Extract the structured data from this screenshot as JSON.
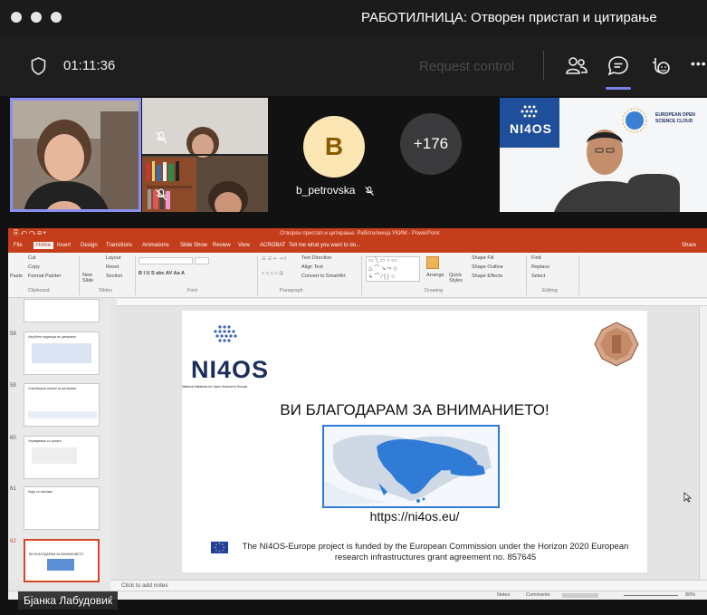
{
  "window": {
    "title": "РАБОТИЛНИЦА: Отворен пристап и цитирање"
  },
  "meeting": {
    "timer": "01:11:36",
    "request_control_label": "Request control",
    "toolbar_icons": [
      "participants-icon",
      "chat-icon",
      "reactions-icon",
      "more-options-icon"
    ],
    "more_label": "•••"
  },
  "participants": {
    "avatar_initial": "B",
    "avatar_name": "b_petrovska",
    "overflow_count": "+176",
    "presenter_name": "Бјанка Лабудовиќ"
  },
  "powerpoint": {
    "title_text": "Отворен пристап и цитирање. Работилница УКИМ - PowerPoint",
    "tabs": [
      "File",
      "Home",
      "Insert",
      "Design",
      "Transitions",
      "Animations",
      "Slide Show",
      "Review",
      "View",
      "ACROBAT",
      "Tell me what you want to do..."
    ],
    "share_label": "Share",
    "ribbon_groups": [
      "Clipboard",
      "Slides",
      "Font",
      "Paragraph",
      "Drawing",
      "Editing"
    ],
    "ribbon_items": {
      "cut": "Cut",
      "copy": "Copy",
      "format_painter": "Format Painter",
      "paste": "Paste",
      "new_slide": "New Slide",
      "layout": "Layout",
      "reset": "Reset",
      "section": "Section",
      "text_direction": "Text Direction",
      "align_text": "Align Text",
      "convert_smartart": "Convert to SmartArt",
      "arrange": "Arrange",
      "quick_styles": "Quick Styles",
      "shape_fill": "Shape Fill",
      "shape_outline": "Shape Outline",
      "shape_effects": "Shape Effects",
      "find": "Find",
      "replace": "Replace",
      "select": "Select"
    },
    "thumbnails": [
      {
        "num": "58",
        "title": "Изгубени податоци во цитирање"
      },
      {
        "num": "59",
        "title": "Софтверски алатки за цитирање"
      },
      {
        "num": "60",
        "title": "Управување со цитати"
      },
      {
        "num": "61",
        "title": "Каде се наоѓаме"
      },
      {
        "num": "62",
        "title": "ВИ БЛАГОДАРАМ ЗА ВНИМАНИЕТО"
      }
    ],
    "notes_placeholder": "Click to add notes",
    "status": {
      "notes": "Notes",
      "comments": "Comments",
      "zoom": "80%"
    }
  },
  "slide": {
    "logo_text": "NI4OS",
    "logo_subtitle": "National Initiatives for Open Science in Europe",
    "heading": "ВИ БЛАГОДАРАМ ЗА ВНИМАНИЕТО!",
    "url": "https://ni4os.eu/",
    "footer_line1": "The NI4OS-Europe project is funded by the European Commission under the Horizon 2020 European",
    "footer_line2": "research infrastructures grant agreement no. 857645"
  },
  "eosc_banner": {
    "text_line1": "EUROPEAN OPEN",
    "text_line2": "SCIENCE CLOUD",
    "logo_text": "NI4OS"
  },
  "colors": {
    "accent": "#7b83eb",
    "ppt_red": "#c43e1c",
    "avatar_bg": "#fbe6b4",
    "map_blue": "#2f7bd6"
  }
}
